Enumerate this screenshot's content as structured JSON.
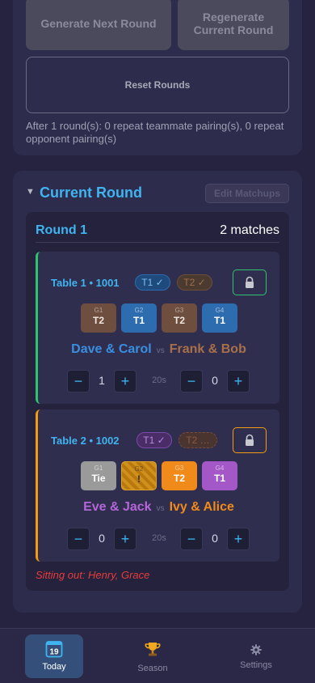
{
  "top": {
    "generate_next": "Generate Next Round",
    "regenerate": "Regenerate Current Round",
    "reset": "Reset Rounds",
    "repeat_summary": "After 1 round(s): 0 repeat teammate pairing(s), 0 repeat opponent pairing(s)"
  },
  "section": {
    "caret": "▼",
    "title": "Current Round",
    "edit_matchups": "Edit Matchups"
  },
  "round": {
    "title": "Round 1",
    "count": "2 matches"
  },
  "tables": [
    {
      "label": "Table 1 • 1001",
      "pill1": "T1 ✓",
      "pill2": "T2 ✓",
      "games": [
        {
          "num": "G1",
          "result": "T2"
        },
        {
          "num": "G2",
          "result": "T1"
        },
        {
          "num": "G3",
          "result": "T2"
        },
        {
          "num": "G4",
          "result": "T1"
        }
      ],
      "team_a": "Dave & Carol",
      "vs": "vs",
      "team_b": "Frank & Bob",
      "score_a": "1",
      "score_b": "0",
      "timer": "20s"
    },
    {
      "label": "Table 2 • 1002",
      "pill1": "T1 ✓",
      "pill2": "T2 …",
      "games": [
        {
          "num": "G1",
          "result": "Tie"
        },
        {
          "num": "G2",
          "result": "!"
        },
        {
          "num": "G3",
          "result": "T2"
        },
        {
          "num": "G4",
          "result": "T1"
        }
      ],
      "team_a": "Eve & Jack",
      "vs": "vs",
      "team_b": "Ivy & Alice",
      "score_a": "0",
      "score_b": "0",
      "timer": "20s"
    }
  ],
  "stepper": {
    "minus": "−",
    "plus": "+"
  },
  "sitting_out": "Sitting out: Henry, Grace",
  "nav": {
    "today_day": "19",
    "today": "Today",
    "season": "Season",
    "settings": "Settings"
  },
  "icons": [
    "lock-icon",
    "calendar-icon",
    "trophy-icon",
    "gear-icon",
    "caret-down-icon"
  ],
  "colors": {
    "accent": "#3fb4f0",
    "table1_border": "#2ec46e",
    "table2_border": "#f39c12",
    "sitting_out": "#e83c3c"
  }
}
